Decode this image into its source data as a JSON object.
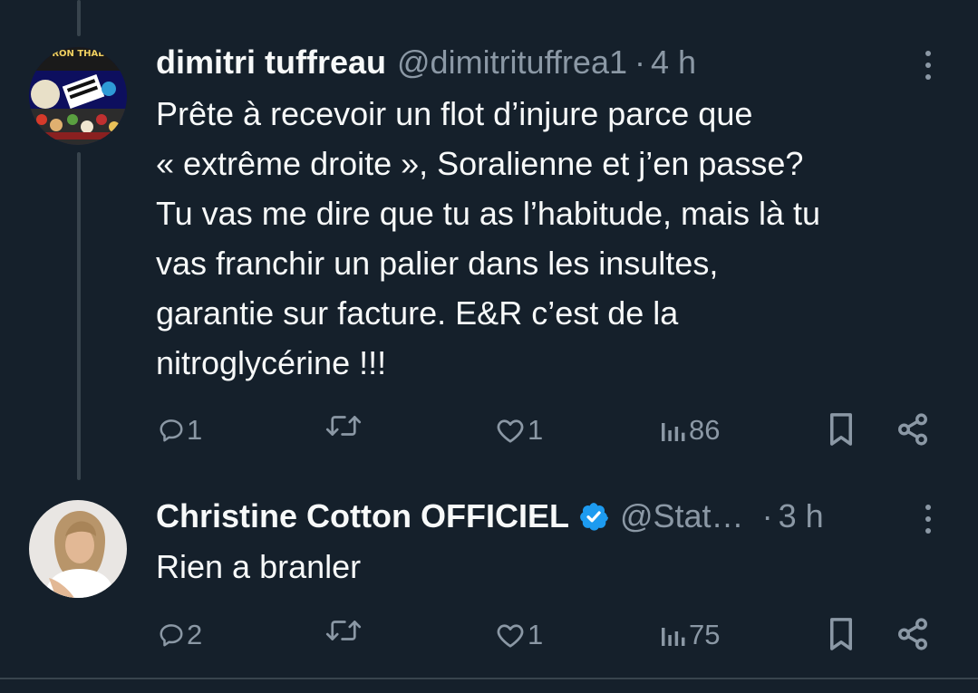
{
  "tweets": [
    {
      "display_name": "dimitri tuffreau",
      "handle": "@dimitrituffrea1",
      "separator": "·",
      "time": "4 h",
      "avatar_text": "RON THAL",
      "text_lines": [
        "Prête à recevoir un flot d’injure parce que",
        "« extrême droite », Soralienne et j’en passe?",
        "Tu vas me dire que tu as l’habitude, mais là tu",
        "vas franchir un palier dans les insultes,",
        "garantie sur facture. E&R c’est de la",
        "nitroglycérine !!!"
      ],
      "replies": "1",
      "retweets": "",
      "likes": "1",
      "views": "86"
    },
    {
      "display_name": "Christine Cotton OFFICIEL",
      "handle": "@Stat…",
      "separator": "·",
      "time": "3 h",
      "verified": true,
      "text_lines": [
        "Rien a branler"
      ],
      "replies": "2",
      "retweets": "",
      "likes": "1",
      "views": "75"
    }
  ],
  "colors": {
    "background": "#15202b",
    "text_primary": "#f7f9f9",
    "text_secondary": "#8b98a5",
    "verified_blue": "#1d9bf0",
    "divider": "#38444d"
  },
  "icons": [
    "reply-icon",
    "retweet-icon",
    "like-icon",
    "views-icon",
    "bookmark-icon",
    "share-icon",
    "more-icon",
    "verified-badge-icon"
  ]
}
